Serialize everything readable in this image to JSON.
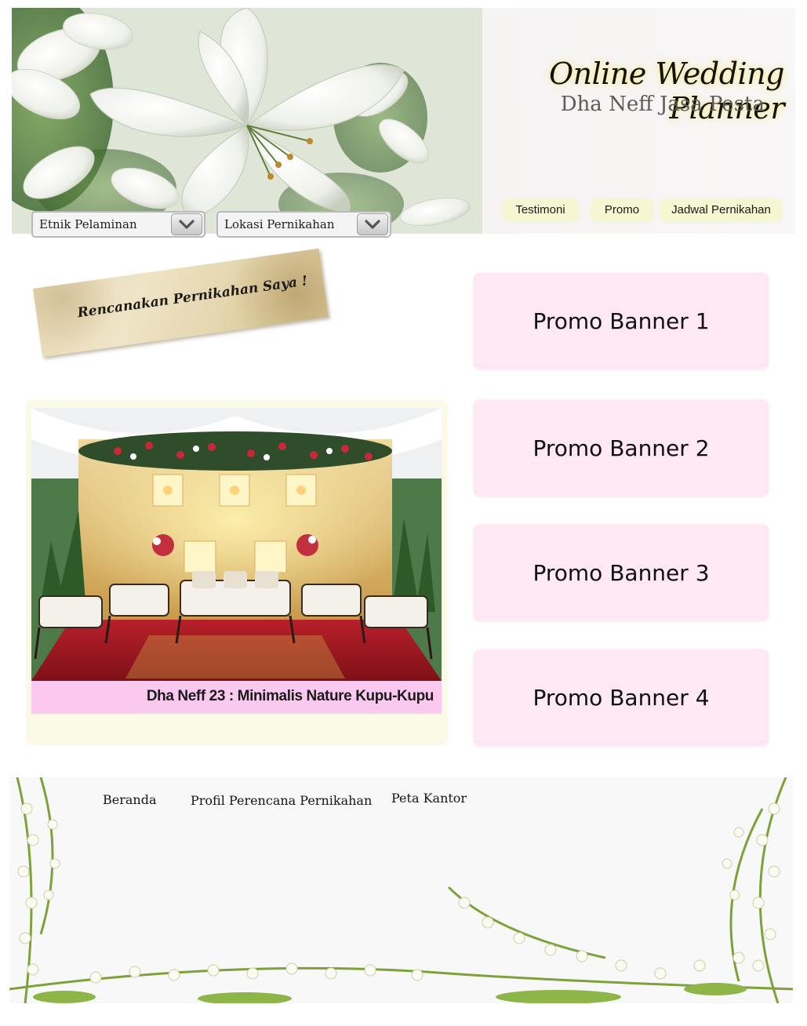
{
  "header": {
    "title": "Online Wedding Planner",
    "subtitle": "Dha Neff Jasa Pesta",
    "nav": [
      {
        "label": "Testimoni"
      },
      {
        "label": "Promo"
      },
      {
        "label": "Jadwal Pernikahan"
      }
    ],
    "dropdowns": [
      {
        "selected": "Etnik Pelaminan"
      },
      {
        "selected": "Lokasi Pernikahan"
      }
    ]
  },
  "main": {
    "plan_note": "Rencanakan Pernikahan Saya !",
    "feature": {
      "caption": "Dha Neff 23 : Minimalis Nature Kupu-Kupu"
    },
    "promos": [
      {
        "label": "Promo Banner 1"
      },
      {
        "label": "Promo Banner 2"
      },
      {
        "label": "Promo Banner 3"
      },
      {
        "label": "Promo Banner 4"
      }
    ]
  },
  "footer": {
    "links": [
      {
        "label": "Beranda"
      },
      {
        "label": "Profil Perencana Pernikahan"
      },
      {
        "label": "Peta Kantor"
      }
    ]
  },
  "colors": {
    "pill_bg": "#f6f6d2",
    "promo_bg": "#fde8f4",
    "caption_bg": "#fbc8ef",
    "feature_card_bg": "#fafae6"
  }
}
